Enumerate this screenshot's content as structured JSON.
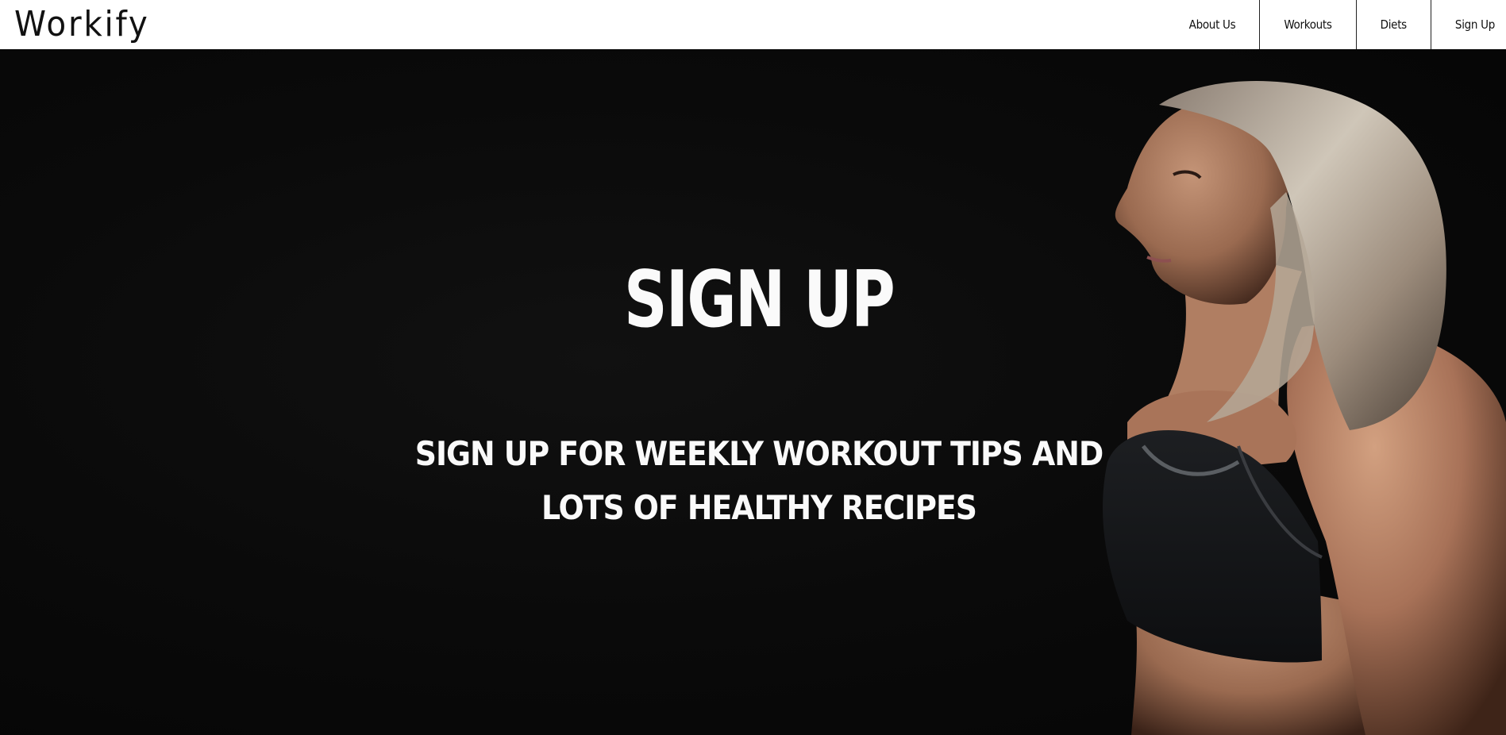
{
  "navbar": {
    "logo": "Workify",
    "links": [
      {
        "label": "About Us"
      },
      {
        "label": "Workouts"
      },
      {
        "label": "Diets"
      },
      {
        "label": "Sign Up"
      }
    ]
  },
  "hero": {
    "title": "SIGN UP",
    "subtitle": "SIGN UP FOR WEEKLY WORKOUT TIPS AND LOTS OF HEALTHY RECIPES",
    "background_color": "#0a0a0a",
    "text_color": "#fafafa"
  }
}
